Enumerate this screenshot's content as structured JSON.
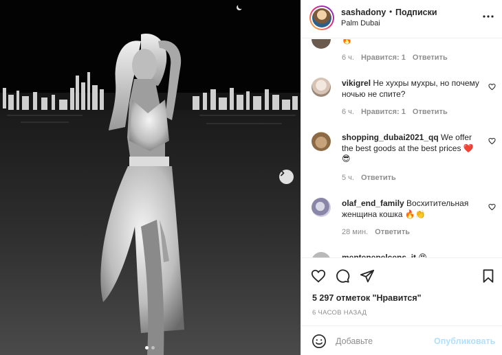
{
  "header": {
    "username": "sashadony",
    "separator": "•",
    "follow_label": "Подписки",
    "location": "Palm Dubai",
    "more_icon": "more-horizontal-icon"
  },
  "comments": [
    {
      "username": "",
      "text": "🔥",
      "time": "6 ч.",
      "likes": "Нравится: 1",
      "reply": "Ответить"
    },
    {
      "username": "vikigrel",
      "text": "Не хухры мухры, но почему ночью не спите?",
      "time": "6 ч.",
      "likes": "Нравится: 1",
      "reply": "Ответить"
    },
    {
      "username": "shopping_dubai2021_qq",
      "text": "We offer the best goods at the best prices ❤️😎",
      "time": "5 ч.",
      "reply": "Ответить"
    },
    {
      "username": "olaf_end_family",
      "text": "Восхитительная женщина кошка 🔥👏",
      "time": "28 мин.",
      "reply": "Ответить"
    },
    {
      "username": "mentenepelcens_it",
      "text": "😍"
    }
  ],
  "actions": {
    "likes_text": "5 297 отметок \"Нравится\"",
    "time_ago": "6 ЧАСОВ НАЗАД"
  },
  "add_comment": {
    "placeholder": "Добавьте",
    "publish_label": "Опубликовать"
  },
  "colors": {
    "accent": "#0095f6",
    "publish_disabled": "#b2dffc",
    "muted": "#8e8e8e"
  },
  "carousel": {
    "current": 1,
    "total": 2
  }
}
